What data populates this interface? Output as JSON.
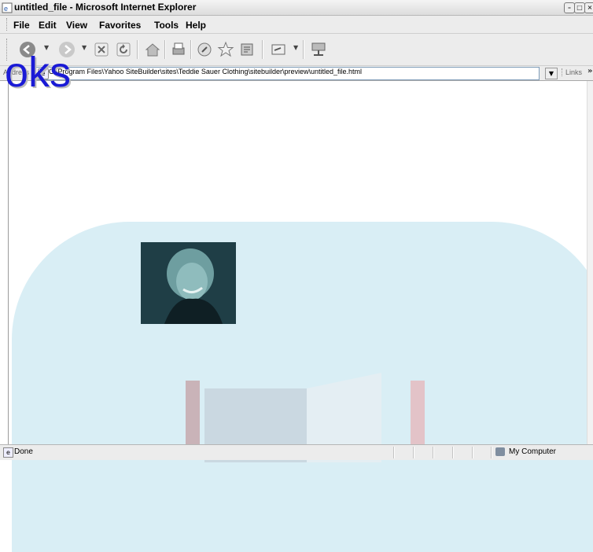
{
  "window": {
    "title": "untitled_file - Microsoft Internet Explorer",
    "controls": {
      "minimize": "–",
      "maximize": "□",
      "close": "×"
    }
  },
  "menu": [
    "File",
    "Edit",
    "View",
    "Favorites",
    "Tools",
    "Help"
  ],
  "toolbar": {
    "icons": [
      "back-icon",
      "forward-icon",
      "stop-icon",
      "refresh-icon",
      "home-icon",
      "print-icon",
      "media-icon",
      "favorites-icon",
      "history-icon",
      "edit-icon",
      "network-icon"
    ]
  },
  "address": {
    "label": "Address",
    "value": "C:\\Program Files\\Yahoo SiteBuilder\\sites\\Teddie Sauer Clothing\\sitebuilder\\preview\\untitled_file.html",
    "links_label": "Links",
    "links_chevron": "»"
  },
  "overlay": {
    "text": "oks"
  },
  "status": {
    "text": "Done",
    "zone": "My Computer"
  },
  "colors": {
    "panel": "#d9eef5",
    "overlay_text": "#1a1ad6",
    "photo_tint": "#1f3e46"
  }
}
